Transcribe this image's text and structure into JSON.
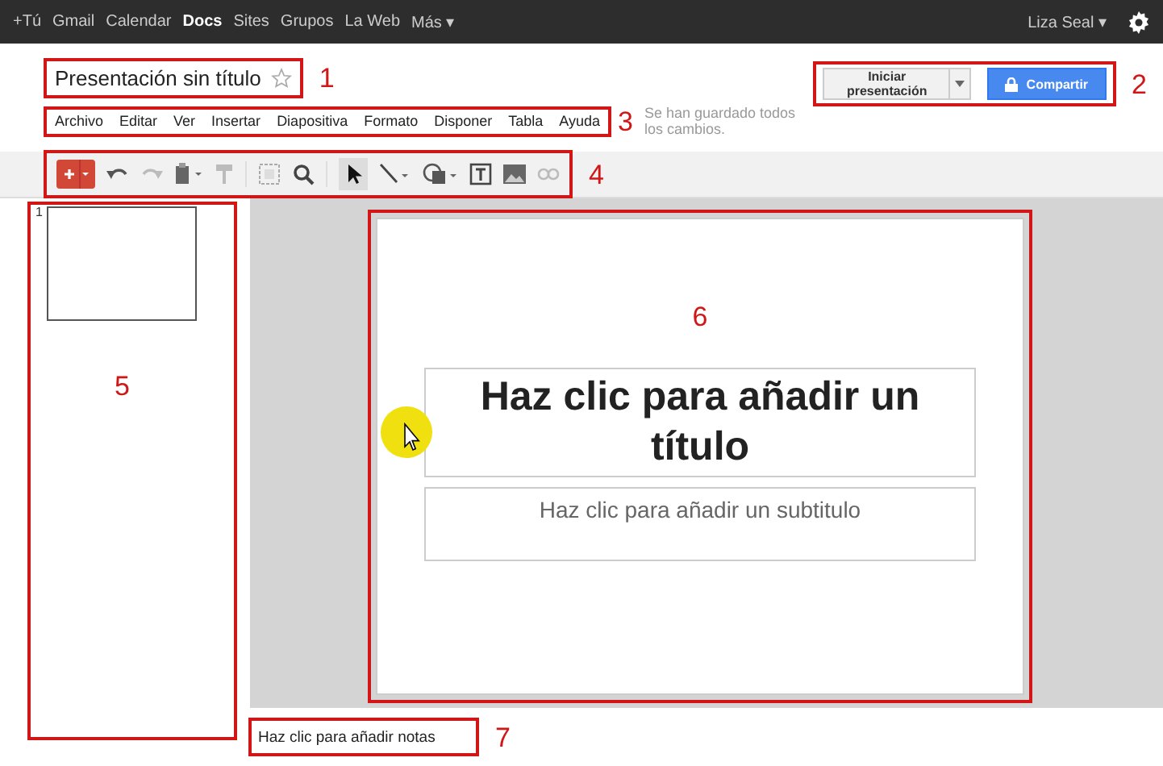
{
  "topbar": {
    "links": [
      {
        "label": "+Tú",
        "selected": false
      },
      {
        "label": "Gmail",
        "selected": false
      },
      {
        "label": "Calendar",
        "selected": false
      },
      {
        "label": "Docs",
        "selected": true
      },
      {
        "label": "Sites",
        "selected": false
      },
      {
        "label": "Grupos",
        "selected": false
      },
      {
        "label": "La Web",
        "selected": false
      },
      {
        "label": "Más ▾",
        "selected": false
      }
    ],
    "user": "Liza Seal ▾"
  },
  "document": {
    "title": "Presentación sin título",
    "save_status": "Se han guardado todos los cambios."
  },
  "menu": [
    "Archivo",
    "Editar",
    "Ver",
    "Insertar",
    "Diapositiva",
    "Formato",
    "Disponer",
    "Tabla",
    "Ayuda"
  ],
  "buttons": {
    "present": "Iniciar presentación",
    "share": "Compartir"
  },
  "filmstrip": {
    "slides": [
      {
        "number": "1",
        "selected": true
      }
    ]
  },
  "slide": {
    "title_placeholder": "Haz clic para añadir un título",
    "subtitle_placeholder": "Haz clic para añadir un subtitulo"
  },
  "notes": {
    "placeholder": "Haz clic para añadir notas"
  },
  "annotations": [
    "1",
    "2",
    "3",
    "4",
    "5",
    "6",
    "7"
  ]
}
